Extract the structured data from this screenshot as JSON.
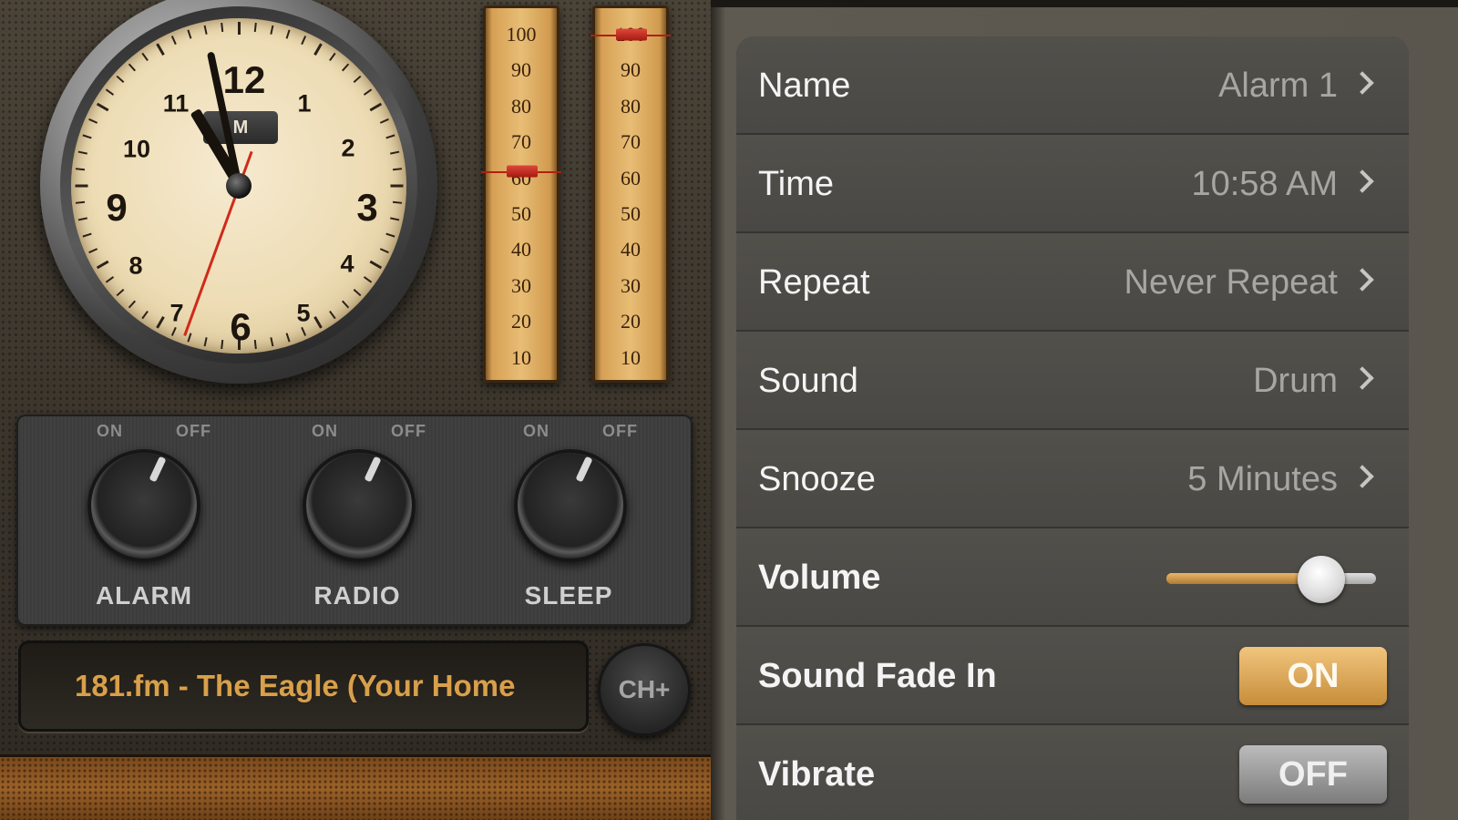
{
  "clock": {
    "numerals": [
      "12",
      "1",
      "2",
      "3",
      "4",
      "5",
      "6",
      "7",
      "8",
      "9",
      "10",
      "11"
    ],
    "badge": "M"
  },
  "meters": {
    "scale": [
      "100",
      "90",
      "80",
      "70",
      "60",
      "50",
      "40",
      "30",
      "20",
      "10"
    ],
    "left_level": 62,
    "right_level": 100
  },
  "knobs": [
    {
      "on": "ON",
      "off": "OFF",
      "label": "ALARM"
    },
    {
      "on": "ON",
      "off": "OFF",
      "label": "RADIO"
    },
    {
      "on": "ON",
      "off": "OFF",
      "label": "SLEEP"
    }
  ],
  "station": {
    "text": "181.fm - The Eagle (Your Home",
    "channel_button": "CH+"
  },
  "settings": {
    "rows": [
      {
        "label": "Name",
        "value": "Alarm 1"
      },
      {
        "label": "Time",
        "value": "10:58 AM"
      },
      {
        "label": "Repeat",
        "value": "Never Repeat"
      },
      {
        "label": "Sound",
        "value": "Drum"
      },
      {
        "label": "Snooze",
        "value": "5 Minutes"
      }
    ],
    "volume": {
      "label": "Volume",
      "level": 0.74
    },
    "fade_in": {
      "label": "Sound Fade In",
      "state": "ON"
    },
    "vibrate": {
      "label": "Vibrate",
      "state": "OFF"
    }
  },
  "colors": {
    "accent": "#d8a04a",
    "toggle_on": "#d9a553",
    "toggle_off": "#9a9a9a"
  }
}
